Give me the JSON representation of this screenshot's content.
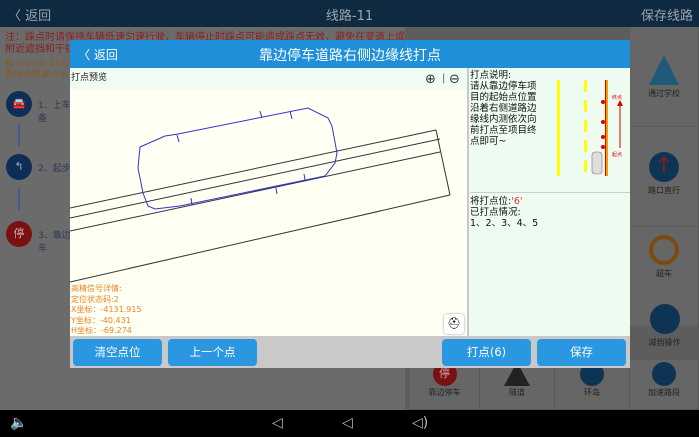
{
  "topbar": {
    "back": "〈 返回",
    "title": "线路-11",
    "save": "保存线路"
  },
  "note": "注：踩点时请保持车辆低速匀速行驶，车辆停止时踩点可能造成踩点无效，避免在变道上或附近遮挡和干扰较严重位置踩点",
  "info": {
    "lat": "有 Lat:30.31829",
    "distance": "距踩点距离:0米"
  },
  "steps": [
    {
      "icon": "car-icon",
      "label": "1、上车准备"
    },
    {
      "icon": "start-icon",
      "label": "2、起步"
    },
    {
      "icon": "stop-icon",
      "label": "3、靠边停车"
    }
  ],
  "grid": {
    "tiles": [
      "通过学校",
      "路口直行",
      "超车",
      "减档操作",
      "靠边停车",
      "隧道",
      "环岛",
      "加速路段"
    ]
  },
  "dialog": {
    "back": "〈 返回",
    "title": "靠边停车道路右侧边缘线打点",
    "preview_title": "打点预览",
    "zoom_in": "⊕",
    "zoom_out": "⊖",
    "gnss": {
      "title": "高精信号详情:",
      "status": "定位状态码:2",
      "x": "X坐标：-4131.915",
      "y": "Y坐标：-40.431",
      "h": "H坐标：-69.274"
    },
    "instructions": "打点说明:\n请从靠边停车项目的起始点位置沿着右侧道路边缘线内测依次向前打点至项目终点即可~",
    "diagram": {
      "end_label": "终点",
      "start_label": "起点",
      "n_labels": [
        "n",
        "n-1",
        "2",
        "1"
      ]
    },
    "next_point_label": "将打点位:",
    "next_point_value": "'6'",
    "done_label": "已打点情况:",
    "done_points": "1、2、3、4、5",
    "buttons": {
      "clear": "清空点位",
      "previous": "上一个点",
      "mark": "打点(6)",
      "save": "保存"
    }
  },
  "navbar": {
    "back": "◁",
    "home": "⌂",
    "recent": "▢"
  },
  "colors": {
    "header": "#1e8fd8",
    "button": "#2a97e0",
    "track": "#3333cc",
    "gnss_text": "#e8852a"
  }
}
